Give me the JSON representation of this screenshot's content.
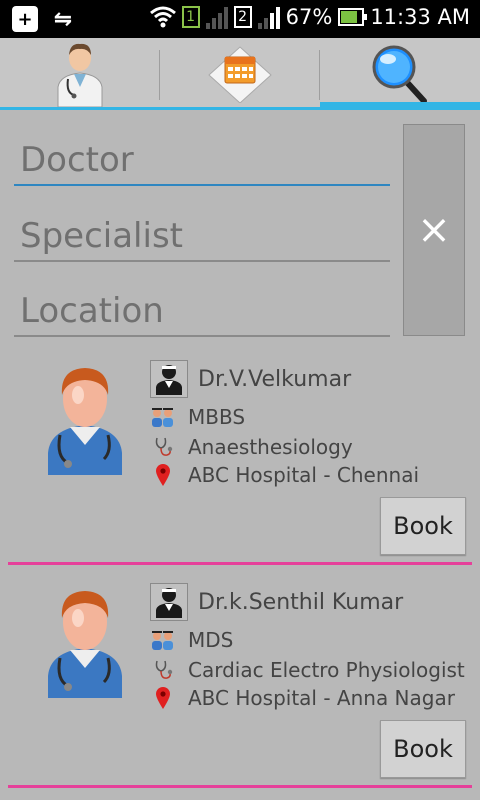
{
  "status_bar": {
    "sim1": "1",
    "sim2": "2",
    "battery": "67%",
    "time": "11:33 AM"
  },
  "tabs": [
    {
      "name": "doctor-tab",
      "icon": "doctor-icon"
    },
    {
      "name": "appointment-tab",
      "icon": "calendar-icon"
    },
    {
      "name": "search-tab",
      "icon": "magnifier-icon"
    }
  ],
  "search": {
    "doctor_placeholder": "Doctor",
    "specialist_placeholder": "Specialist",
    "location_placeholder": "Location",
    "clear_label": "×"
  },
  "doctors": [
    {
      "name": "Dr.V.Velkumar",
      "degree": "MBBS",
      "specialty": "Anaesthesiology",
      "hospital": "ABC Hospital - Chennai",
      "book_label": "Book"
    },
    {
      "name": "Dr.k.Senthil Kumar",
      "degree": "MDS",
      "specialty": "Cardiac Electro Physiologist",
      "hospital": "ABC Hospital - Anna Nagar",
      "book_label": "Book"
    }
  ],
  "colors": {
    "accent": "#33b5e5",
    "separator": "#e6409a",
    "background": "#b8b8b8"
  }
}
